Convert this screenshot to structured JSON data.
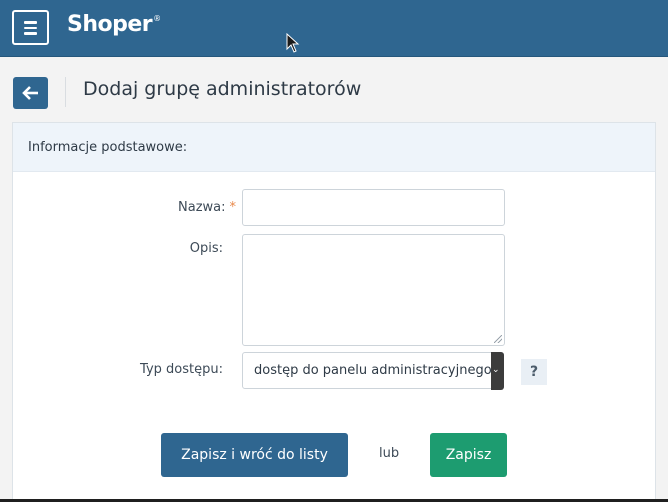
{
  "header": {
    "logo_text": "Shoper",
    "logo_mark": "®",
    "menu_icon": "hamburger-menu-icon"
  },
  "page": {
    "back_icon": "arrow-left-icon",
    "title": "Dodaj grupę administratorów"
  },
  "panel": {
    "header_title": "Informacje podstawowe:"
  },
  "form": {
    "name_label": "Nazwa:",
    "required_mark": "*",
    "name_value": "",
    "description_label": "Opis:",
    "description_value": "",
    "access_label": "Typ dostępu:",
    "access_selected": "dostęp do panelu administracyjnego",
    "help_label": "?"
  },
  "actions": {
    "save_and_return_label": "Zapisz i wróć do listy",
    "or_label": "lub",
    "save_label": "Zapisz"
  },
  "colors": {
    "brand": "#2f6690",
    "success": "#1d9c70",
    "required": "#e8884a",
    "panel_header_bg": "#eef4fa"
  }
}
